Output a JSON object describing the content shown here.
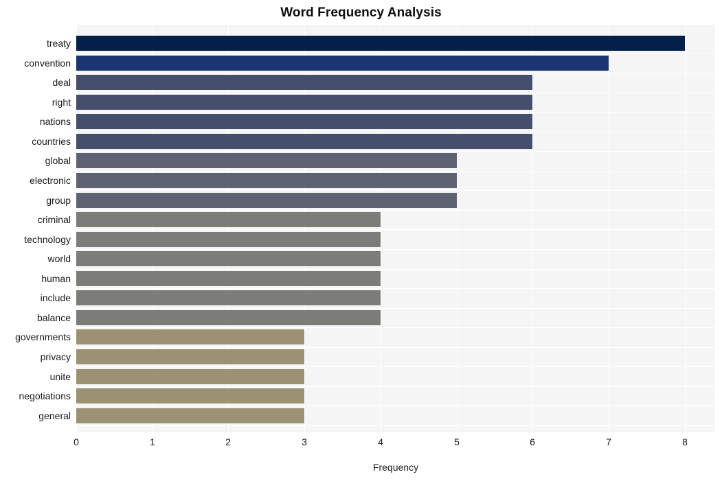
{
  "chart_data": {
    "type": "bar",
    "orientation": "horizontal",
    "title": "Word Frequency Analysis",
    "xlabel": "Frequency",
    "ylabel": "",
    "xlim": [
      0,
      8.4
    ],
    "xticks": [
      "0",
      "1",
      "2",
      "3",
      "4",
      "5",
      "6",
      "7",
      "8"
    ],
    "xtick_values": [
      0,
      1,
      2,
      3,
      4,
      5,
      6,
      7,
      8
    ],
    "grid": true,
    "legend": "none",
    "categories": [
      "treaty",
      "convention",
      "deal",
      "right",
      "nations",
      "countries",
      "global",
      "electronic",
      "group",
      "criminal",
      "technology",
      "world",
      "human",
      "include",
      "balance",
      "governments",
      "privacy",
      "unite",
      "negotiations",
      "general"
    ],
    "values": [
      8,
      7,
      6,
      6,
      6,
      6,
      5,
      5,
      5,
      4,
      4,
      4,
      4,
      4,
      4,
      3,
      3,
      3,
      3,
      3
    ],
    "bar_colors": [
      "#042049",
      "#1c3673",
      "#454e6b",
      "#454e6b",
      "#454e6b",
      "#454e6b",
      "#5e6272",
      "#5e6272",
      "#5e6272",
      "#7c7c78",
      "#7c7c78",
      "#7c7c78",
      "#7c7c78",
      "#7c7c78",
      "#7c7c78",
      "#9a9272",
      "#9a9272",
      "#9a9272",
      "#9a9272",
      "#9a9272"
    ],
    "plot_background": "#f5f5f6",
    "grid_color": "#ffffff",
    "figure_background": "#ffffff"
  }
}
